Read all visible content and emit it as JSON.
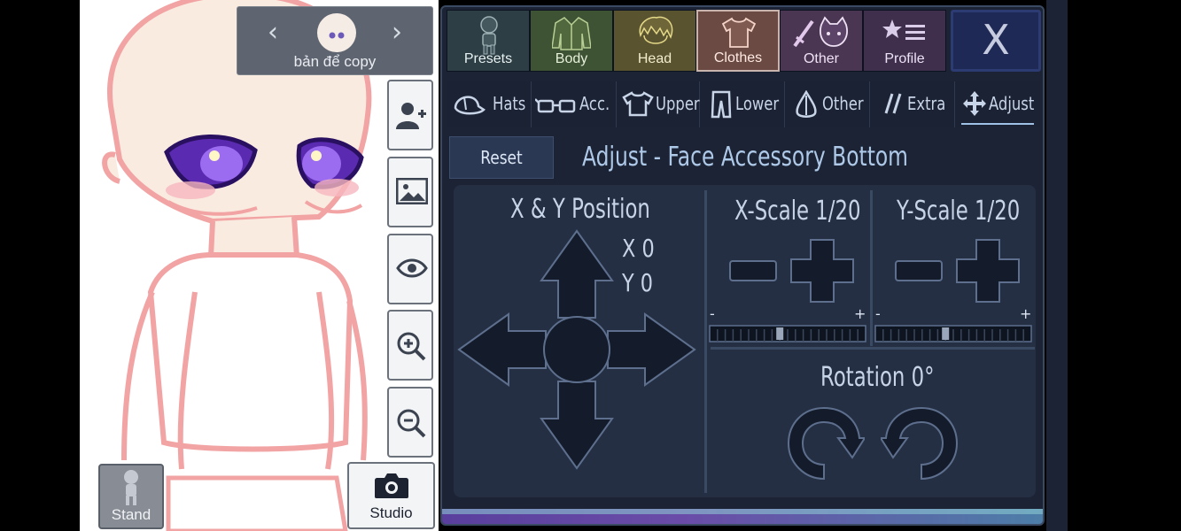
{
  "character": {
    "name": "bản để copy"
  },
  "left_buttons": {
    "stand_label": "Stand",
    "studio_label": "Studio"
  },
  "top_tabs": [
    {
      "label": "Presets",
      "icon": "presets-icon"
    },
    {
      "label": "Body",
      "icon": "jacket-icon"
    },
    {
      "label": "Head",
      "icon": "hair-icon"
    },
    {
      "label": "Clothes",
      "icon": "shirt-icon",
      "active": true
    },
    {
      "label": "Other",
      "icon": "sword-cat-icon"
    },
    {
      "label": "Profile",
      "icon": "star-list-icon"
    }
  ],
  "close_label": "X",
  "sub_tabs": [
    {
      "label": "Hats",
      "icon": "hat-icon"
    },
    {
      "label": "Acc.",
      "icon": "glasses-icon"
    },
    {
      "label": "Upper",
      "icon": "shirt-icon"
    },
    {
      "label": "Lower",
      "icon": "pants-icon"
    },
    {
      "label": "Other",
      "icon": "drop-icon"
    },
    {
      "label": "Extra",
      "icon": "slashes-icon"
    },
    {
      "label": "Adjust",
      "icon": "move-arrows-icon",
      "active": true
    }
  ],
  "reset_label": "Reset",
  "adjust_title": "Adjust - Face Accessory Bottom",
  "position": {
    "title": "X & Y Position",
    "x_label": "X 0",
    "y_label": "Y 0"
  },
  "x_scale": {
    "title": "X-Scale 1/20",
    "minus": "-",
    "plus": "+",
    "level": 0.45
  },
  "y_scale": {
    "title": "Y-Scale 1/20",
    "minus": "-",
    "plus": "+",
    "level": 0.45
  },
  "rotation": {
    "title": "Rotation 0°"
  }
}
